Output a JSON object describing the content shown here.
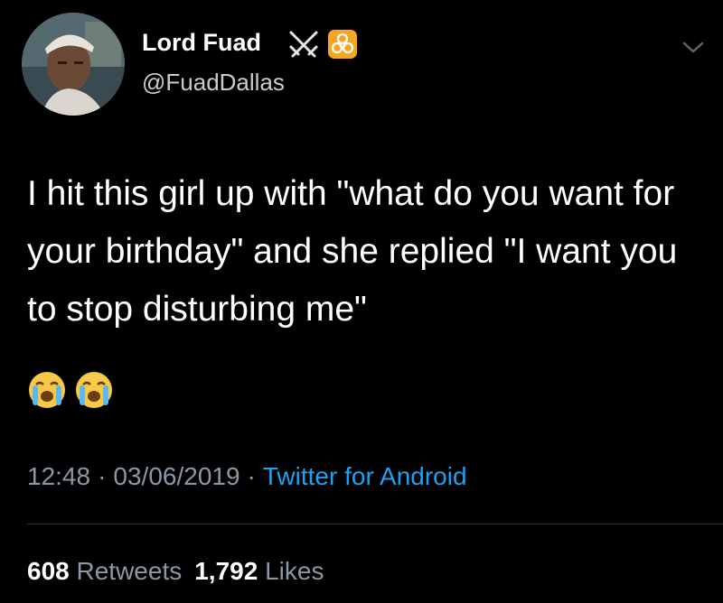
{
  "user": {
    "display_name": "Lord Fuad",
    "handle": "@FuadDallas",
    "name_emojis": [
      "swords-icon",
      "biohazard-icon"
    ]
  },
  "tweet": {
    "text": "I hit this girl up with \"what do you want for your birthday\" and she replied \"I want you to stop disturbing me\"",
    "emojis": [
      "loudly-crying-face-icon",
      "loudly-crying-face-icon"
    ]
  },
  "meta": {
    "time": "12:48",
    "separator": "·",
    "date": "03/06/2019",
    "source": "Twitter for Android"
  },
  "stats": {
    "retweets_count": "608",
    "retweets_label": "Retweets",
    "likes_count": "1,792",
    "likes_label": "Likes"
  },
  "colors": {
    "background": "#000000",
    "link": "#1da1f2",
    "muted": "#8b98a5",
    "biohazard": "#f5a623"
  }
}
